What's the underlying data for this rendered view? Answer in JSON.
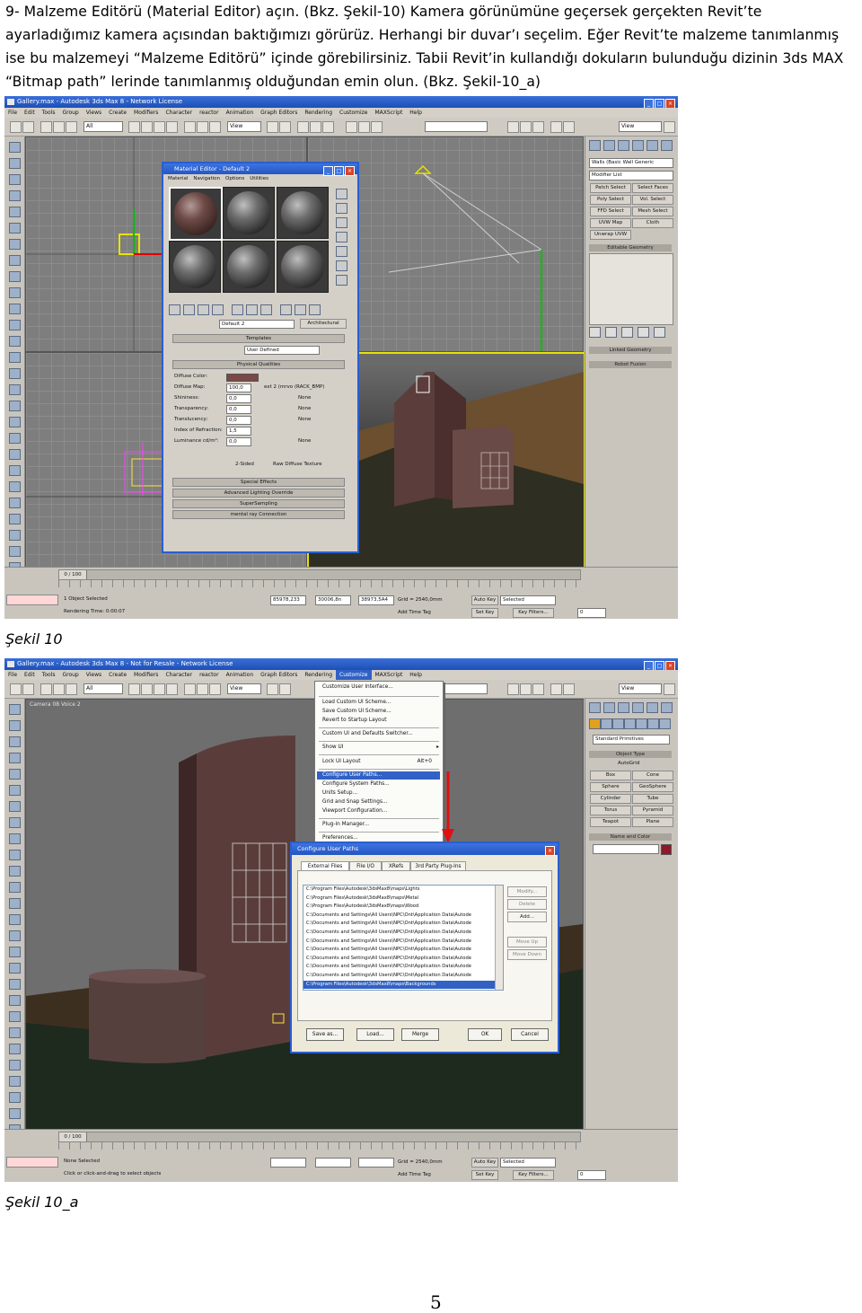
{
  "paragraph": {
    "line1": "9- Malzeme Editörü (Material Editor) açın. (Bkz. Şekil-10) Kamera görünümüne geçersek gerçekten Revit’te",
    "line2": "ayarladığımız kamera açısından baktığımızı görürüz. Herhangi bir duvar’ı seçelim. Eğer Revit’te malzeme tanımlanmış",
    "line3": "ise bu malzemeyi “Malzeme Editörü” içinde görebilirsiniz. Tabii Revit’in kullandığı dokuların bulunduğu dizinin 3ds MAX",
    "line4": "“Bitmap path” lerinde tanımlanmış olduğundan emin olun. (Bkz. Şekil-10_a)"
  },
  "figure1": {
    "caption": "Şekil 10",
    "window_title": "Gallery.max - Autodesk 3ds Max 8 - Network License",
    "menu": [
      "File",
      "Edit",
      "Tools",
      "Group",
      "Views",
      "Create",
      "Modifiers",
      "Character",
      "reactor",
      "Animation",
      "Graph Editors",
      "Rendering",
      "Customize",
      "MAXScript",
      "Help"
    ],
    "toolbar_select": "All",
    "toolbar_view": "View",
    "material_editor": {
      "title": "Material Editor - Default 2",
      "menu": [
        "Material",
        "Navigation",
        "Options",
        "Utilities"
      ],
      "material_name": "Default 2",
      "material_type": "Architectural",
      "rollout_templates": "Templates",
      "template_value": "User Defined",
      "rollout_physical": "Physical Qualities",
      "rows": [
        {
          "label": "Diffuse Color:",
          "value": "",
          "extra": ""
        },
        {
          "label": "Diffuse Map:",
          "value": "100,0",
          "extra": "ext 2 (mrvo (RACK_BMP)"
        },
        {
          "label": "Shininess:",
          "value": "0,0",
          "extra": "None"
        },
        {
          "label": "Transparency:",
          "value": "0,0",
          "extra": "None"
        },
        {
          "label": "Translucency:",
          "value": "0,0",
          "extra": "None"
        },
        {
          "label": "Index of Refraction:",
          "value": "1,5",
          "extra": ""
        },
        {
          "label": "Luminance cd/m²:",
          "value": "0,0",
          "extra": "None"
        }
      ],
      "check_2sided": "2-Sided",
      "check_raw": "Raw Diffuse Texture",
      "rollouts": [
        "Special Effects",
        "Advanced Lighting Override",
        "SuperSampling",
        "mental ray Connection"
      ]
    },
    "right_panel": {
      "dropdown1": "Walls (Basic Wall Generic",
      "modifier_list": "Modifier List",
      "buttons": [
        "Patch Select",
        "Select Faces",
        "Poly Select",
        "Vol. Select",
        "FFD Select",
        "Mesh Select",
        "UVW Map",
        "Cloth",
        "Unwrap UVW"
      ],
      "section": "Editable Geometry",
      "rollouts": [
        "Linked Geometry",
        "Robot Fusion"
      ]
    },
    "timeline": "0 / 100",
    "status1": "1 Object Selected",
    "status2": "Rendering Time: 0:00:07",
    "coords": {
      "x": "85978,233",
      "y": "30006,8n",
      "z": "38973,5A4"
    },
    "grid": "Grid = 2540,0mm",
    "add_time_tag": "Add Time Tag",
    "auto_key": "Auto Key",
    "set_key": "Set Key",
    "selected": "Selected",
    "key_filters": "Key Filters...",
    "frame": "0"
  },
  "figure2": {
    "caption": "Şekil 10_a",
    "window_title": "Gallery.max - Autodesk 3ds Max 8 - Not for Resale - Network License",
    "viewport_label": "Camera 08 Voice 2",
    "customize_menu": [
      "Customize User Interface...",
      "Load Custom UI Scheme...",
      "Save Custom UI Scheme...",
      "Revert to Startup Layout",
      "Custom UI and Defaults Switcher...",
      "Show UI",
      "Lock UI Layout",
      "Configure User Paths...",
      "Configure System Paths...",
      "Units Setup...",
      "Grid and Snap Settings...",
      "Viewport Configuration...",
      "Plug-in Manager...",
      "Preferences..."
    ],
    "lock_shortcut": "Alt+0",
    "dialog": {
      "title": "Configure User Paths",
      "tabs": [
        "External Files",
        "File I/O",
        "XRefs",
        "3rd Party Plug-Ins"
      ],
      "paths": [
        "C:\\Program Files\\Autodesk\\3dsMax8\\maps\\Lights",
        "C:\\Program Files\\Autodesk\\3dsMax8\\maps\\Metal",
        "C:\\Program Files\\Autodesk\\3dsMax8\\maps\\Wood",
        "C:\\Documents and Settings\\All Users\\NPC\\Ont\\Application Data\\Autode",
        "C:\\Documents and Settings\\All Users\\NPC\\Ont\\Application Data\\Autode",
        "C:\\Documents and Settings\\All Users\\NPC\\Ont\\Application Data\\Autode",
        "C:\\Documents and Settings\\All Users\\NPC\\Ont\\Application Data\\Autode",
        "C:\\Documents and Settings\\All Users\\NPC\\Ont\\Application Data\\Autode",
        "C:\\Documents and Settings\\All Users\\NPC\\Ont\\Application Data\\Autode",
        "C:\\Documents and Settings\\All Users\\NPC\\Ont\\Application Data\\Autode",
        "C:\\Documents and Settings\\All Users\\NPC\\Ont\\Application Data\\Autode",
        "C:\\Program Files\\Autodesk\\3dsMax8\\maps\\Backgrounds"
      ],
      "side_buttons": [
        "Modify...",
        "Delete",
        "Add...",
        "Move Up",
        "Move Down"
      ],
      "buttons": [
        "Save as...",
        "Load...",
        "Merge",
        "OK",
        "Cancel"
      ]
    },
    "right_panel": {
      "dropdown": "Standard Primitives",
      "section1": "Object Type",
      "autogrid": "AutoGrid",
      "buttons": [
        "Box",
        "Cone",
        "Sphere",
        "GeoSphere",
        "Cylinder",
        "Tube",
        "Torus",
        "Pyramid",
        "Teapot",
        "Plane"
      ],
      "section2": "Name and Color"
    },
    "timeline": "0 / 100",
    "status1": "None Selected",
    "status2": "Click or click-and-drag to select objects",
    "grid": "Grid = 2540,0mm",
    "add_time_tag": "Add Time Tag",
    "auto_key": "Auto Key",
    "set_key": "Set Key",
    "selected": "Selected",
    "key_filters": "Key Filters...",
    "frame": "0"
  },
  "page_number": "5"
}
